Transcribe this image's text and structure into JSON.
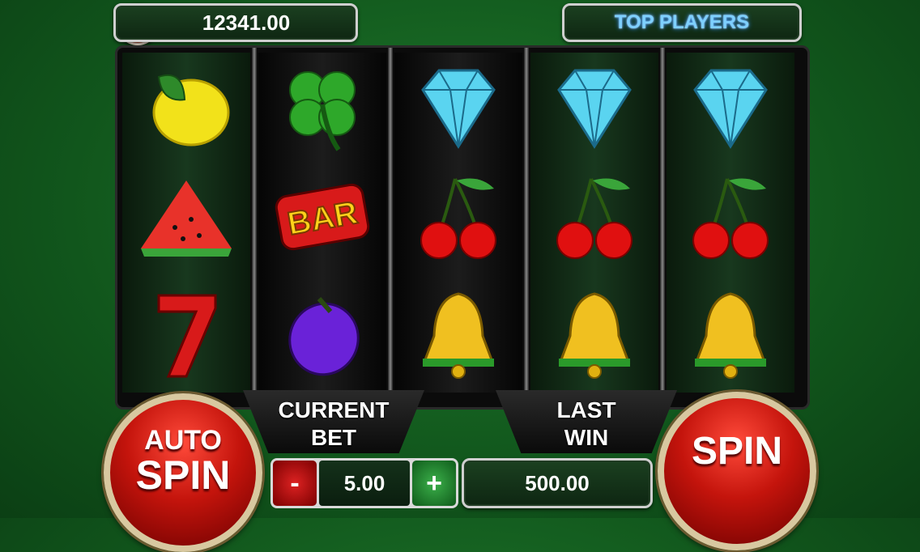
{
  "balance": "12341.00",
  "coin_symbol": "$",
  "top_players_label": "TOP PLAYERS",
  "reels": [
    {
      "symbols": [
        "lemon-icon",
        "watermelon-icon",
        "seven-icon"
      ]
    },
    {
      "symbols": [
        "clover-icon",
        "bar-icon",
        "plum-icon"
      ],
      "bar_text": "BAR"
    },
    {
      "symbols": [
        "diamond-icon",
        "cherry-icon",
        "bell-icon"
      ]
    },
    {
      "symbols": [
        "diamond-icon",
        "cherry-icon",
        "bell-icon"
      ]
    },
    {
      "symbols": [
        "diamond-icon",
        "cherry-icon",
        "bell-icon"
      ]
    }
  ],
  "current_bet": {
    "label_line1": "CURRENT",
    "label_line2": "BET",
    "value": "5.00",
    "minus": "-",
    "plus": "+"
  },
  "last_win": {
    "label_line1": "LAST",
    "label_line2": "WIN",
    "value": "500.00"
  },
  "auto_spin": {
    "line1": "AUTO",
    "line2": "SPIN"
  },
  "spin_label": "SPIN",
  "colors": {
    "felt": "#11561c",
    "button_red": "#c4140c",
    "accent_blue": "#7ed0ff"
  }
}
